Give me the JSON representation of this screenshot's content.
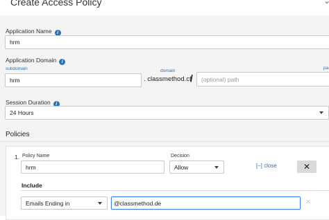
{
  "header": {
    "title": "Create Access Policy"
  },
  "application_name": {
    "label": "Application Name",
    "value": "hrm"
  },
  "application_domain": {
    "label": "Application Domain",
    "subdomain_label": "subdomain",
    "domain_label": "domain",
    "path_label": "pa",
    "subdomain_value": "hrm",
    "domain_value": ". classmethod.cf",
    "slash": "/",
    "path_placeholder": "(optional) path"
  },
  "session_duration": {
    "label": "Session Duration",
    "value": "24 Hours"
  },
  "policies": {
    "title": "Policies",
    "items": [
      {
        "index": "1.",
        "name_label": "Policy Name",
        "name_value": "hrm",
        "decision_label": "Decision",
        "decision_value": "Allow",
        "collapse_link": "[–] close",
        "close_icon": "✕",
        "include_label": "Include",
        "rule_type": "Emails Ending in",
        "rule_value": "@classmethod.de",
        "rule_remove_icon": "✕"
      }
    ]
  }
}
